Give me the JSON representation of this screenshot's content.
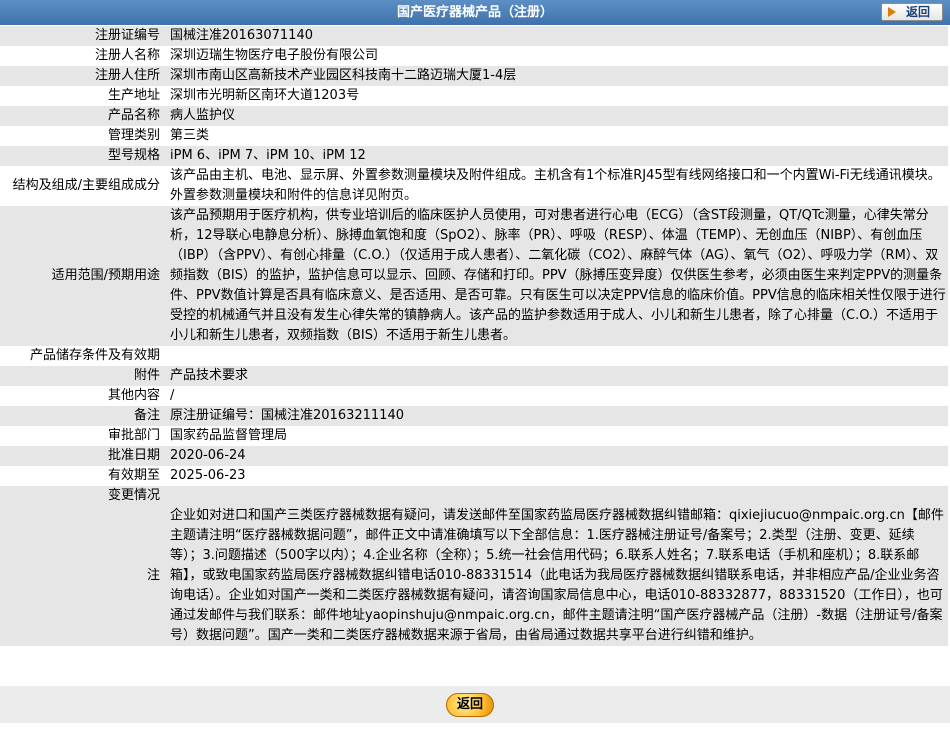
{
  "header": {
    "title": "国产医疗器械产品（注册）",
    "back_label": "返回"
  },
  "rows": [
    {
      "k": "注册证编号",
      "v": "国械注准20163071140"
    },
    {
      "k": "注册人名称",
      "v": "深圳迈瑞生物医疗电子股份有限公司"
    },
    {
      "k": "注册人住所",
      "v": "深圳市南山区高新技术产业园区科技南十二路迈瑞大厦1-4层"
    },
    {
      "k": "生产地址",
      "v": "深圳市光明新区南环大道1203号"
    },
    {
      "k": "产品名称",
      "v": "病人监护仪"
    },
    {
      "k": "管理类别",
      "v": "第三类"
    },
    {
      "k": "型号规格",
      "v": "iPM 6、iPM 7、iPM 10、iPM 12"
    },
    {
      "k": "结构及组成/主要组成成分",
      "v": "该产品由主机、电池、显示屏、外置参数测量模块及附件组成。主机含有1个标准RJ45型有线网络接口和一个内置Wi-Fi无线通讯模块。外置参数测量模块和附件的信息详见附页。"
    },
    {
      "k": "适用范围/预期用途",
      "v": "该产品预期用于医疗机构，供专业培训后的临床医护人员使用，可对患者进行心电（ECG）（含ST段测量，QT/QTc测量，心律失常分析，12导联心电静息分析）、脉搏血氧饱和度（SpO2）、脉率（PR）、呼吸（RESP）、体温（TEMP）、无创血压（NIBP）、有创血压（IBP）（含PPV）、有创心排量（C.O.）（仅适用于成人患者）、二氧化碳（CO2）、麻醉气体（AG）、氧气（O2）、呼吸力学（RM）、双频指数（BIS）的监护，监护信息可以显示、回顾、存储和打印。PPV（脉搏压变异度）仅供医生参考，必须由医生来判定PPV的测量条件、PPV数值计算是否具有临床意义、是否适用、是否可靠。只有医生可以决定PPV信息的临床价值。PPV信息的临床相关性仅限于进行受控的机械通气并且没有发生心律失常的镇静病人。该产品的监护参数适用于成人、小儿和新生儿患者，除了心排量（C.O.）不适用于小儿和新生儿患者，双频指数（BIS）不适用于新生儿患者。"
    },
    {
      "k": "产品储存条件及有效期",
      "v": ""
    },
    {
      "k": "附件",
      "v": "产品技术要求"
    },
    {
      "k": "其他内容",
      "v": "/"
    },
    {
      "k": "备注",
      "v": "原注册证编号：国械注准20163211140"
    },
    {
      "k": "审批部门",
      "v": "国家药品监督管理局"
    },
    {
      "k": "批准日期",
      "v": "2020-06-24"
    },
    {
      "k": "有效期至",
      "v": "2025-06-23"
    },
    {
      "k": "变更情况",
      "v": ""
    },
    {
      "k": "注",
      "v": "企业如对进口和国产三类医疗器械数据有疑问，请发送邮件至国家药监局医疗器械数据纠错邮箱：qixiejiucuo@nmpaic.org.cn【邮件主题请注明“医疗器械数据问题”，邮件正文中请准确填写以下全部信息：1.医疗器械注册证号/备案号；2.类型（注册、变更、延续等）；3.问题描述（500字以内）；4.企业名称（全称）；5.统一社会信用代码；6.联系人姓名；7.联系电话（手机和座机）；8.联系邮箱】，或致电国家药监局医疗器械数据纠错电话010-88331514（此电话为我局医疗器械数据纠错联系电话，并非相应产品/企业业务咨询电话）。企业如对国产一类和二类医疗器械数据有疑问，请咨询国家局信息中心，电话010-88332877，88331520（工作日），也可通过发邮件与我们联系：邮件地址yaopinshuju@nmpaic.org.cn，邮件主题请注明“国产医疗器械产品（注册）-数据（注册证号/备案号）数据问题”。国产一类和二类医疗器械数据来源于省局，由省局通过数据共享平台进行纠错和维护。"
    }
  ]
}
